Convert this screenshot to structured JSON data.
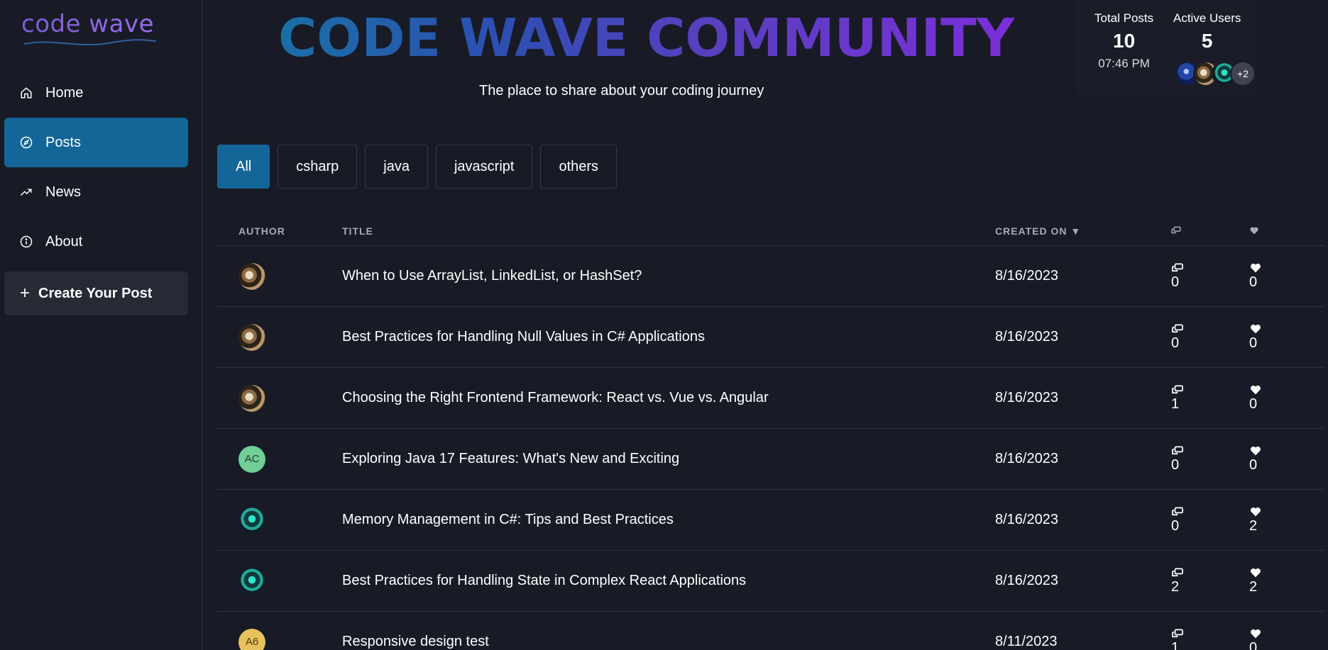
{
  "logo": {
    "text": "code wave"
  },
  "nav": {
    "items": [
      {
        "label": "Home",
        "icon": "home-icon",
        "active": false
      },
      {
        "label": "Posts",
        "icon": "compass-icon",
        "active": true
      },
      {
        "label": "News",
        "icon": "trending-icon",
        "active": false
      },
      {
        "label": "About",
        "icon": "info-icon",
        "active": false
      }
    ],
    "create_label": "Create Your Post"
  },
  "header": {
    "title": "CODE WAVE COMMUNITY",
    "subtitle": "The place to share about your coding journey"
  },
  "stats": {
    "total_posts_label": "Total Posts",
    "total_posts": "10",
    "time": "07:46 PM",
    "active_users_label": "Active Users",
    "active_users": "5",
    "more_users": "+2"
  },
  "filters": [
    "All",
    "csharp",
    "java",
    "javascript",
    "others"
  ],
  "active_filter": "All",
  "table": {
    "headers": {
      "author": "AUTHOR",
      "title": "TITLE",
      "created": "CREATED ON ▼"
    },
    "rows": [
      {
        "avatar": "swirl",
        "initials": "",
        "title": "When to Use ArrayList, LinkedList, or HashSet?",
        "date": "8/16/2023",
        "comments": "0",
        "likes": "0"
      },
      {
        "avatar": "swirl",
        "initials": "",
        "title": "Best Practices for Handling Null Values in C# Applications",
        "date": "8/16/2023",
        "comments": "0",
        "likes": "0"
      },
      {
        "avatar": "swirl",
        "initials": "",
        "title": "Choosing the Right Frontend Framework: React vs. Vue vs. Angular",
        "date": "8/16/2023",
        "comments": "1",
        "likes": "0"
      },
      {
        "avatar": "green",
        "initials": "AC",
        "title": "Exploring Java 17 Features: What's New and Exciting",
        "date": "8/16/2023",
        "comments": "0",
        "likes": "0"
      },
      {
        "avatar": "robot",
        "initials": "",
        "title": "Memory Management in C#: Tips and Best Practices",
        "date": "8/16/2023",
        "comments": "0",
        "likes": "2"
      },
      {
        "avatar": "robot",
        "initials": "",
        "title": "Best Practices for Handling State in Complex React Applications",
        "date": "8/16/2023",
        "comments": "2",
        "likes": "2"
      },
      {
        "avatar": "yellow",
        "initials": "A6",
        "title": "Responsive design test",
        "date": "8/11/2023",
        "comments": "1",
        "likes": "0"
      }
    ]
  },
  "colors": {
    "background": "#181b26",
    "accent": "#146598",
    "title_gradient_start": "#1a6fa6",
    "title_gradient_end": "#7a2fd8"
  }
}
